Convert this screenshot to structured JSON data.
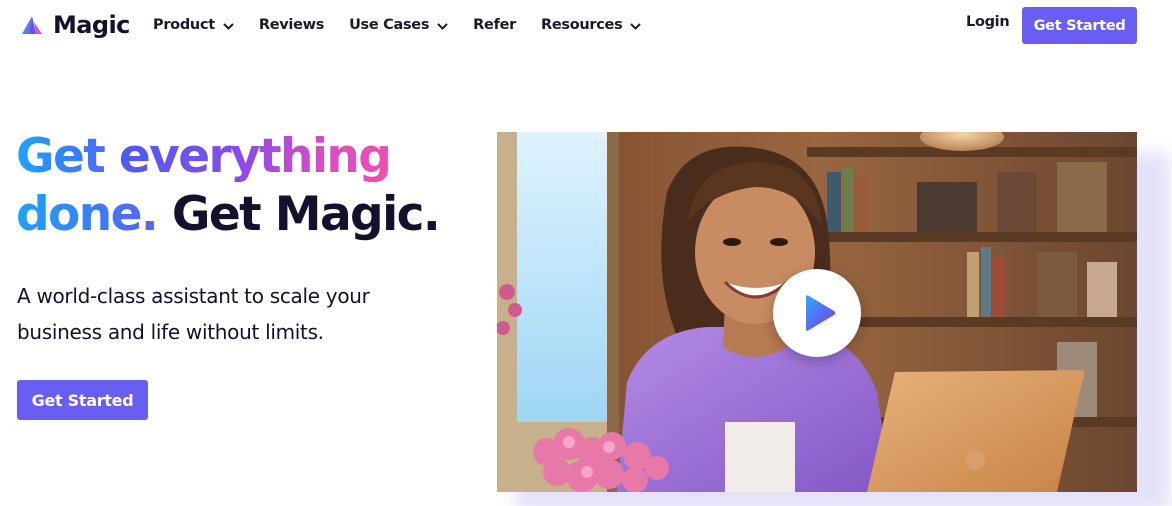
{
  "brand": {
    "name": "Magic",
    "logo_icon": "magic-logo-icon",
    "accent_color": "#6a5df2"
  },
  "nav": {
    "items": [
      {
        "label": "Product",
        "has_dropdown": true
      },
      {
        "label": "Reviews",
        "has_dropdown": false
      },
      {
        "label": "Use Cases",
        "has_dropdown": true
      },
      {
        "label": "Refer",
        "has_dropdown": false
      },
      {
        "label": "Resources",
        "has_dropdown": true
      }
    ],
    "login_label": "Login",
    "cta_label": "Get Started"
  },
  "hero": {
    "headline_part1": "Get ",
    "headline_part2": "everything",
    "headline_part3": "done.",
    "headline_part4": " Get Magic.",
    "subheadline_line1": "A world-class assistant to scale your",
    "subheadline_line2": "business and life without limits.",
    "cta_label": "Get Started"
  },
  "video": {
    "thumbnail_description": "play-button-icon"
  }
}
